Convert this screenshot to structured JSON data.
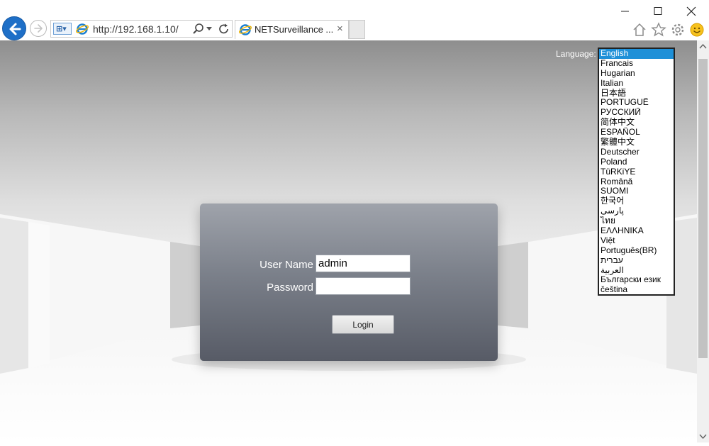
{
  "browser": {
    "url": "http://192.168.1.10/",
    "tab_title": "NETSurveillance ...",
    "tab_close": "×",
    "compat_label": "⊞▾"
  },
  "language": {
    "label": "Language:",
    "selected": "English",
    "options": [
      "English",
      "Francais",
      "Hugarian",
      "Italian",
      "日本語",
      "PORTUGUÊ",
      "РУССКИЙ",
      "简体中文",
      "ESPAÑOL",
      "繁體中文",
      "Deutscher",
      "Poland",
      "TüRKiYE",
      "Română",
      "SUOMI",
      "한국어",
      "پارسی",
      "ไทย",
      "ΕΛΛΗΝΙΚΑ",
      "Việt",
      "Português(BR)",
      "עברית",
      "العربية",
      "Български език",
      "čeština"
    ]
  },
  "login": {
    "username_label": "User Name",
    "username_value": "admin",
    "password_label": "Password",
    "password_value": "",
    "button_label": "Login"
  },
  "colors": {
    "accent": "#1e6fc7",
    "selected_option": "#1e90d8",
    "panel_top": "#9fa3ab",
    "panel_bottom": "#575b66"
  },
  "icons": {
    "back": "back-arrow-icon",
    "forward": "forward-arrow-icon",
    "home": "home-icon",
    "favorites": "star-icon",
    "tools": "gear-icon",
    "feedback": "smiley-icon"
  }
}
